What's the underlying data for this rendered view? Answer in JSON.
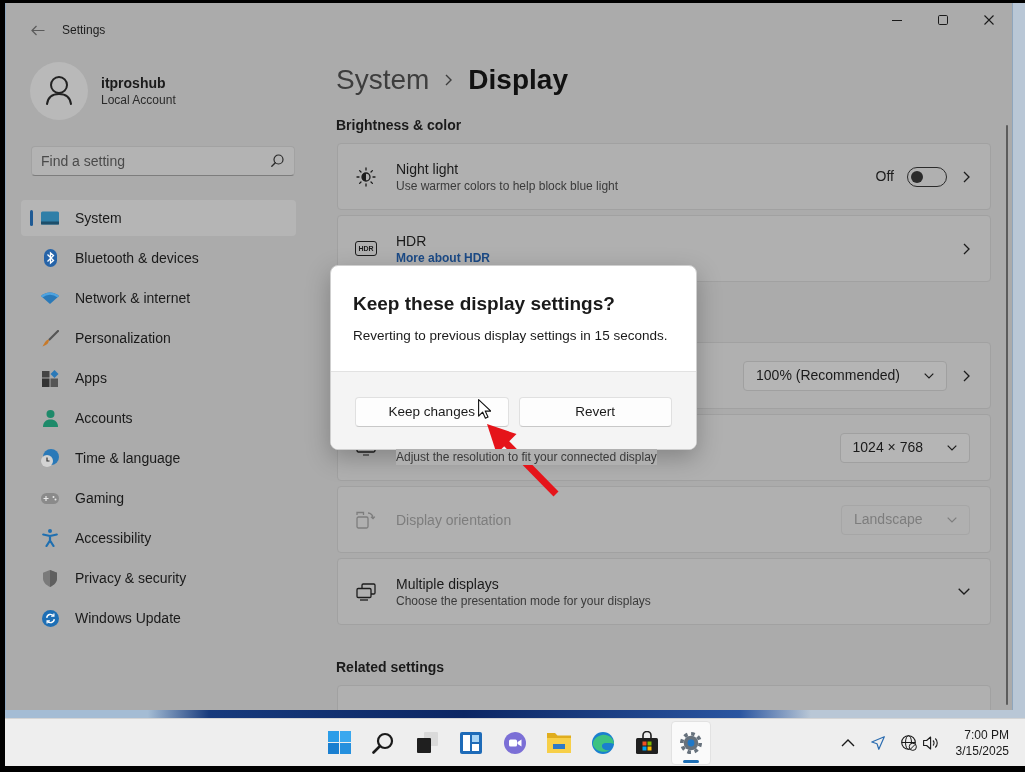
{
  "window": {
    "title": "Settings"
  },
  "account": {
    "name": "itproshub",
    "type": "Local Account"
  },
  "search": {
    "placeholder": "Find a setting"
  },
  "sidebar": {
    "items": [
      {
        "label": "System",
        "selected": true
      },
      {
        "label": "Bluetooth & devices",
        "selected": false
      },
      {
        "label": "Network & internet",
        "selected": false
      },
      {
        "label": "Personalization",
        "selected": false
      },
      {
        "label": "Apps",
        "selected": false
      },
      {
        "label": "Accounts",
        "selected": false
      },
      {
        "label": "Time & language",
        "selected": false
      },
      {
        "label": "Gaming",
        "selected": false
      },
      {
        "label": "Accessibility",
        "selected": false
      },
      {
        "label": "Privacy & security",
        "selected": false
      },
      {
        "label": "Windows Update",
        "selected": false
      }
    ]
  },
  "breadcrumb": {
    "parent": "System",
    "current": "Display"
  },
  "sections": [
    {
      "heading": "Brightness & color",
      "cards": [
        {
          "kind": "toggle",
          "title": "Night light",
          "subtitle": "Use warmer colors to help block blue light",
          "state_label": "Off",
          "on": false,
          "chevron": true,
          "disabled": false
        },
        {
          "kind": "link",
          "badge": "HDR",
          "title": "HDR",
          "link": "More about HDR",
          "chevron": true,
          "disabled": false
        }
      ]
    },
    {
      "cards": [
        {
          "kind": "dropdown",
          "value": "100% (Recommended)",
          "chevron": true,
          "disabled": false
        },
        {
          "kind": "dropdown",
          "subtitle": "Adjust the resolution to fit your connected display",
          "value": "1024 × 768",
          "chevron": false,
          "disabled": false
        },
        {
          "kind": "dropdown",
          "title": "Display orientation",
          "value": "Landscape",
          "chevron": false,
          "disabled": true
        },
        {
          "kind": "expander",
          "title": "Multiple displays",
          "subtitle": "Choose the presentation mode for your displays",
          "expanded": false,
          "disabled": false
        }
      ]
    },
    {
      "heading": "Related settings",
      "cards": [
        {
          "kind": "plain"
        }
      ]
    }
  ],
  "dialog": {
    "title": "Keep these display settings?",
    "message": "Reverting to previous display settings in 15 seconds.",
    "buttons": [
      {
        "label": "Keep changes"
      },
      {
        "label": "Revert"
      }
    ]
  },
  "taskbar": {
    "apps": [
      {
        "active": false
      },
      {
        "active": false
      },
      {
        "active": false
      },
      {
        "active": false
      },
      {
        "active": false
      },
      {
        "active": false
      },
      {
        "active": false
      },
      {
        "active": false
      },
      {
        "active": true
      }
    ],
    "clock": {
      "time": "7:00 PM",
      "date": "3/15/2025"
    }
  }
}
